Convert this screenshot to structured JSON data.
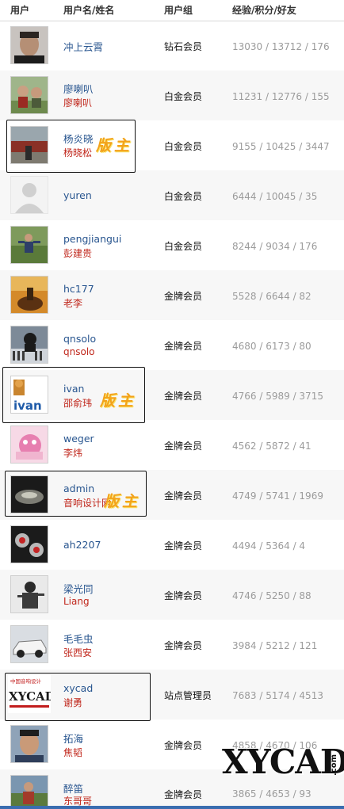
{
  "table": {
    "headers": {
      "user": "用户",
      "name": "用户名/姓名",
      "group": "用户组",
      "stats": "经验/积分/好友"
    },
    "moderator_badge": "版主",
    "rows": [
      {
        "username": "冲上云霄",
        "realname": "",
        "group": "钻石会员",
        "stats": "13030 / 13712 / 176"
      },
      {
        "username": "廖喇叭",
        "realname": "廖喇叭",
        "group": "白金会员",
        "stats": "11231 / 12776 / 155"
      },
      {
        "username": "杨炎晓",
        "realname": "杨晓松",
        "group": "白金会员",
        "stats": "9155 / 10425 / 3447"
      },
      {
        "username": "yuren",
        "realname": "",
        "group": "白金会员",
        "stats": "6444 / 10045 / 35"
      },
      {
        "username": "pengjiangui",
        "realname": "彭建贵",
        "group": "白金会员",
        "stats": "8244 / 9034 / 176"
      },
      {
        "username": "hc177",
        "realname": "老李",
        "group": "金牌会员",
        "stats": "5528 / 6644 / 82"
      },
      {
        "username": "qnsolo",
        "realname": "qnsolo",
        "group": "金牌会员",
        "stats": "4680 / 6173 / 80"
      },
      {
        "username": "ivan",
        "realname": "邵俞玮",
        "group": "金牌会员",
        "stats": "4766 / 5989 / 3715"
      },
      {
        "username": "weger",
        "realname": "李炜",
        "group": "金牌会员",
        "stats": "4562 / 5872 / 41"
      },
      {
        "username": "admin",
        "realname": "音响设计网",
        "group": "金牌会员",
        "stats": "4749 / 5741 / 1969"
      },
      {
        "username": "ah2207",
        "realname": "",
        "group": "金牌会员",
        "stats": "4494 / 5364 / 4"
      },
      {
        "username": "梁光同",
        "realname": "Liang",
        "group": "金牌会员",
        "stats": "4746 / 5250 / 88"
      },
      {
        "username": "毛毛虫",
        "realname": "张西安",
        "group": "金牌会员",
        "stats": "3984 / 5212 / 121"
      },
      {
        "username": "xycad",
        "realname": "谢勇",
        "group": "站点管理员",
        "stats": "7683 / 5174 / 4513"
      },
      {
        "username": "拓海",
        "realname": "焦韬",
        "group": "金牌会员",
        "stats": "4858 / 4670 / 106"
      },
      {
        "username": "醉笛",
        "realname": "东哥哥",
        "group": "金牌会员",
        "stats": "3865 / 4653 / 93"
      }
    ],
    "avatar_texts": {
      "ivan": "ivan",
      "xycad_top": "中国音响设计",
      "xycad_logo": "XYCAD"
    }
  },
  "watermark": {
    "text": "XYCAD",
    "suffix": ".com"
  },
  "colors": {
    "username": "#28558f",
    "realname": "#c0271c",
    "stats": "#9b9b9b",
    "badge": "#f3a21a"
  }
}
